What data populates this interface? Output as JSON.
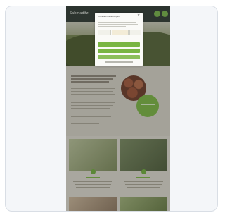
{
  "header": {
    "logo_text": "Sahmaditz"
  },
  "cookie_banner": {
    "title": "Cookie-Einstellungen",
    "close_symbol": "×"
  },
  "colors": {
    "brand_green": "#77b34a",
    "header_dark": "#2f3a34"
  },
  "icons": {
    "close": "close-icon",
    "header_button_1": "circle-icon",
    "header_button_2": "circle-icon"
  }
}
